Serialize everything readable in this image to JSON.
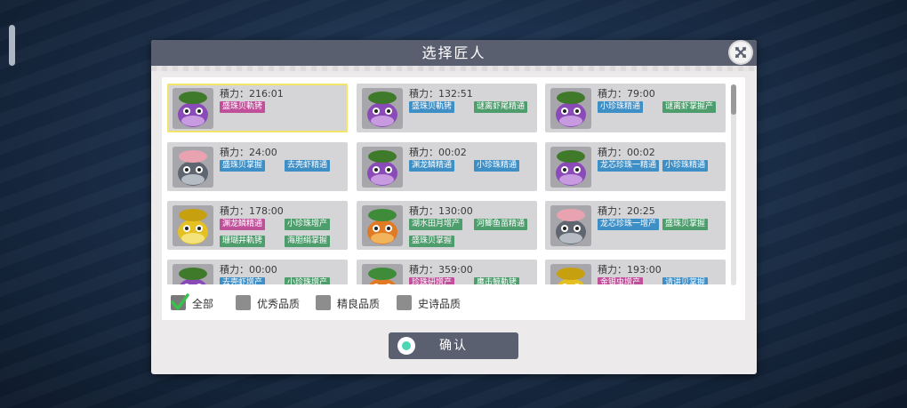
{
  "dialog": {
    "title": "选择匠人",
    "confirm_label": "确认"
  },
  "power_label": "積力：",
  "cards": [
    {
      "portrait": "purple-fish",
      "time": "216:01",
      "selected": true,
      "tags": [
        {
          "text": "盛珠贝軌铐",
          "color": "pink"
        }
      ]
    },
    {
      "portrait": "purple-fish",
      "time": "132:51",
      "selected": false,
      "tags": [
        {
          "text": "盛珠贝軌铐",
          "color": "blue"
        },
        {
          "text": "谜离虾尾精通",
          "color": "green"
        }
      ]
    },
    {
      "portrait": "purple-fish",
      "time": "79:00",
      "selected": false,
      "tags": [
        {
          "text": "小珍珠精通",
          "color": "blue"
        },
        {
          "text": "谜离虾掌握产",
          "color": "green"
        }
      ]
    },
    {
      "portrait": "shell-fish",
      "time": "24:00",
      "selected": false,
      "tags": [
        {
          "text": "盛珠贝掌握",
          "color": "blue"
        },
        {
          "text": "去壳虾精通",
          "color": "blue"
        }
      ]
    },
    {
      "portrait": "purple-fish",
      "time": "00:02",
      "selected": false,
      "tags": [
        {
          "text": "渊龙鳞精通",
          "color": "blue"
        },
        {
          "text": "小珍珠精通",
          "color": "blue"
        }
      ]
    },
    {
      "portrait": "purple-fish",
      "time": "00:02",
      "selected": false,
      "tags": [
        {
          "text": "龙芯珍珠一精通",
          "color": "blue"
        },
        {
          "text": "小珍珠精通",
          "color": "blue"
        }
      ]
    },
    {
      "portrait": "yellow-fish",
      "time": "178:00",
      "selected": false,
      "tags": [
        {
          "text": "渊龙鳞精通",
          "color": "pink"
        },
        {
          "text": "小珍珠增产",
          "color": "green"
        },
        {
          "text": "珊瑚井軌铐",
          "color": "green"
        },
        {
          "text": "海胆绢掌握",
          "color": "green"
        }
      ]
    },
    {
      "portrait": "orange-fish",
      "time": "130:00",
      "selected": false,
      "tags": [
        {
          "text": "湖水田月增产",
          "color": "green"
        },
        {
          "text": "河鲫鱼苗精通",
          "color": "green"
        },
        {
          "text": "盛珠贝掌握",
          "color": "green"
        }
      ]
    },
    {
      "portrait": "shell-fish",
      "time": "20:25",
      "selected": false,
      "tags": [
        {
          "text": "龙芯珍珠一增产",
          "color": "blue"
        },
        {
          "text": "盛珠贝掌握",
          "color": "green"
        }
      ]
    },
    {
      "portrait": "purple-fish",
      "time": "00:00",
      "selected": false,
      "tags": [
        {
          "text": "去壳虾增产",
          "color": "blue"
        },
        {
          "text": "小珍珠增产",
          "color": "green"
        }
      ]
    },
    {
      "portrait": "orange-fish",
      "time": "359:00",
      "selected": false,
      "tags": [
        {
          "text": "珍珠研增产",
          "color": "pink"
        },
        {
          "text": "鹰击鲸軌铐",
          "color": "green"
        }
      ]
    },
    {
      "portrait": "yellow-fish",
      "time": "193:00",
      "selected": false,
      "tags": [
        {
          "text": "金银虫增产",
          "color": "pink"
        },
        {
          "text": "请讲贝掌握",
          "color": "blue"
        }
      ]
    }
  ],
  "filters": [
    {
      "label": "全部",
      "checked": true
    },
    {
      "label": "优秀品质",
      "checked": false
    },
    {
      "label": "精良品质",
      "checked": false
    },
    {
      "label": "史诗品质",
      "checked": false
    }
  ],
  "colors": {
    "header": "#5a5f70",
    "tag_pink": "#c0509a",
    "tag_blue": "#3f8fc7",
    "tag_green": "#4e9d6d",
    "selected_border": "#f3e46a",
    "confirm_accent": "#4ed6b4"
  },
  "icons": {
    "close": "close-x-icon",
    "confirm": "confirm-circle-icon",
    "check": "checkmark-icon"
  }
}
